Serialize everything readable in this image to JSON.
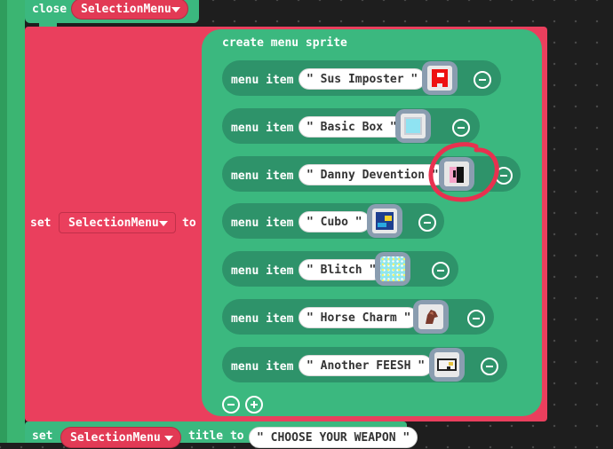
{
  "blocks": {
    "close_block": {
      "keyword": "close",
      "variable": "SelectionMenu"
    },
    "set_block": {
      "keyword": "set",
      "variable": "SelectionMenu",
      "to_label": "to"
    },
    "create_menu": {
      "title": "create menu sprite",
      "item_label": "menu item",
      "items": [
        {
          "text": "\" Sus Imposter \"",
          "image": "red-imposter-icon"
        },
        {
          "text": "\" Basic Box \"",
          "image": "light-blue-box-icon"
        },
        {
          "text": "\" Danny Devention \"",
          "image": "pink-black-sprite-icon"
        },
        {
          "text": "\" Cubo \"",
          "image": "blue-yellow-cube-icon"
        },
        {
          "text": "\" Blitch \"",
          "image": "cyan-noise-icon"
        },
        {
          "text": "\" Horse Charm \"",
          "image": "horse-head-icon"
        },
        {
          "text": "\" Another FEESH \"",
          "image": "fish-icon"
        }
      ]
    },
    "title_block": {
      "keyword": "set",
      "variable": "SelectionMenu",
      "property": "title to",
      "value": "\" CHOOSE YOUR WEAPON \""
    }
  },
  "colors": {
    "menu_green": "#3bb87f",
    "pill_green": "#2e936a",
    "set_red": "#ea3f5d",
    "annotation_red": "#e8314f",
    "background": "#1e1e1e"
  }
}
